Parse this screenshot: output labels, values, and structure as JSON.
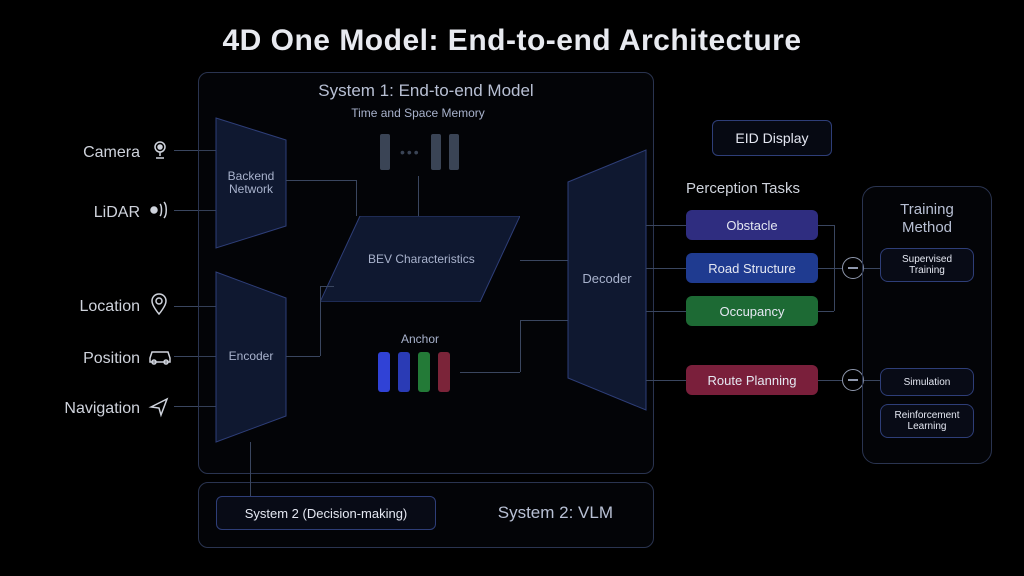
{
  "title": "4D One Model: End-to-end Architecture",
  "inputs": {
    "camera": "Camera",
    "lidar": "LiDAR",
    "location": "Location",
    "position": "Position",
    "navigation": "Navigation"
  },
  "system1": {
    "panel_title": "System 1: End-to-end Model",
    "backend_network": "Backend\nNetwork",
    "encoder": "Encoder",
    "decoder": "Decoder",
    "memory_label": "Time and Space Memory",
    "bev_label": "BEV Characteristics",
    "anchor_label": "Anchor"
  },
  "system2": {
    "panel_title": "System 2: VLM",
    "decision_box": "System 2 (Decision-making)"
  },
  "output": {
    "eid": "EID Display",
    "perception_header": "Perception Tasks",
    "tasks": {
      "obstacle": "Obstacle",
      "road": "Road Structure",
      "occupancy": "Occupancy",
      "route": "Route Planning"
    }
  },
  "training": {
    "header": "Training\nMethod",
    "supervised": "Supervised\nTraining",
    "simulation": "Simulation",
    "rl": "Reinforcement\nLearning"
  },
  "icons": {
    "camera": "camera",
    "lidar": "lidar",
    "location": "location-pin",
    "position": "car",
    "navigation": "arrow-cursor"
  }
}
